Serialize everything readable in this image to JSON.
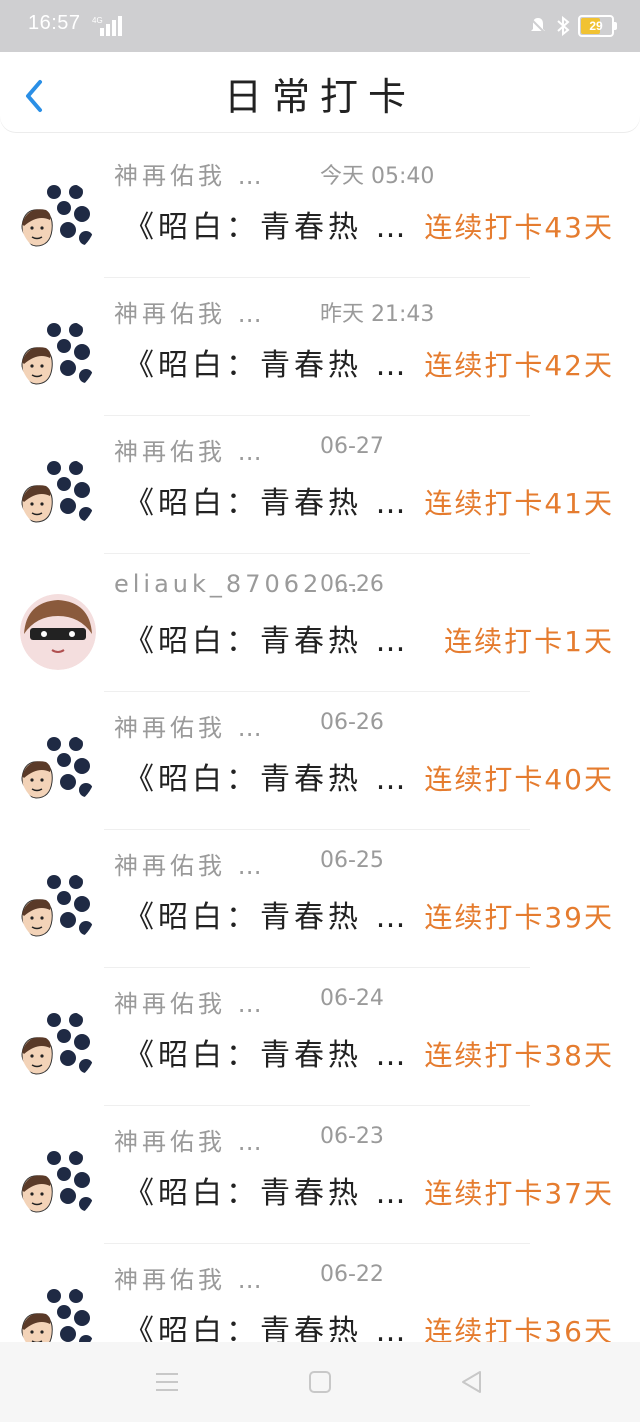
{
  "status_bar": {
    "time": "16:57",
    "network": "4G",
    "battery": "29"
  },
  "header": {
    "title": "日常打卡",
    "back_icon": "chevron-left-icon"
  },
  "colors": {
    "accent_back": "#2a8fe6",
    "streak": "#e57c2f",
    "meta": "#9a9a9a"
  },
  "items": [
    {
      "name": "神再佑我 …",
      "date": "今天 05:40",
      "post": "《昭白：青春热 …",
      "streak": "连续打卡43天",
      "avatar": "meme-avatar"
    },
    {
      "name": "神再佑我 …",
      "date": "昨天 21:43",
      "post": "《昭白：青春热 …",
      "streak": "连续打卡42天",
      "avatar": "meme-avatar"
    },
    {
      "name": "神再佑我 …",
      "date": "06-27",
      "post": "《昭白：青春热 …",
      "streak": "连续打卡41天",
      "avatar": "meme-avatar"
    },
    {
      "name": "eliauk_87062 …",
      "date": "06-26",
      "post": "《昭白：青春热 …",
      "streak": "连续打卡1天",
      "avatar": "anime-girl-avatar"
    },
    {
      "name": "神再佑我 …",
      "date": "06-26",
      "post": "《昭白：青春热 …",
      "streak": "连续打卡40天",
      "avatar": "meme-avatar"
    },
    {
      "name": "神再佑我 …",
      "date": "06-25",
      "post": "《昭白：青春热 …",
      "streak": "连续打卡39天",
      "avatar": "meme-avatar"
    },
    {
      "name": "神再佑我 …",
      "date": "06-24",
      "post": "《昭白：青春热 …",
      "streak": "连续打卡38天",
      "avatar": "meme-avatar"
    },
    {
      "name": "神再佑我 …",
      "date": "06-23",
      "post": "《昭白：青春热 …",
      "streak": "连续打卡37天",
      "avatar": "meme-avatar"
    },
    {
      "name": "神再佑我 …",
      "date": "06-22",
      "post": "《昭白：青春热 …",
      "streak": "连续打卡36天",
      "avatar": "meme-avatar"
    }
  ],
  "nav_bar": {
    "menu_icon": "menu-icon",
    "home_icon": "home-square-icon",
    "back_icon": "back-triangle-icon"
  }
}
